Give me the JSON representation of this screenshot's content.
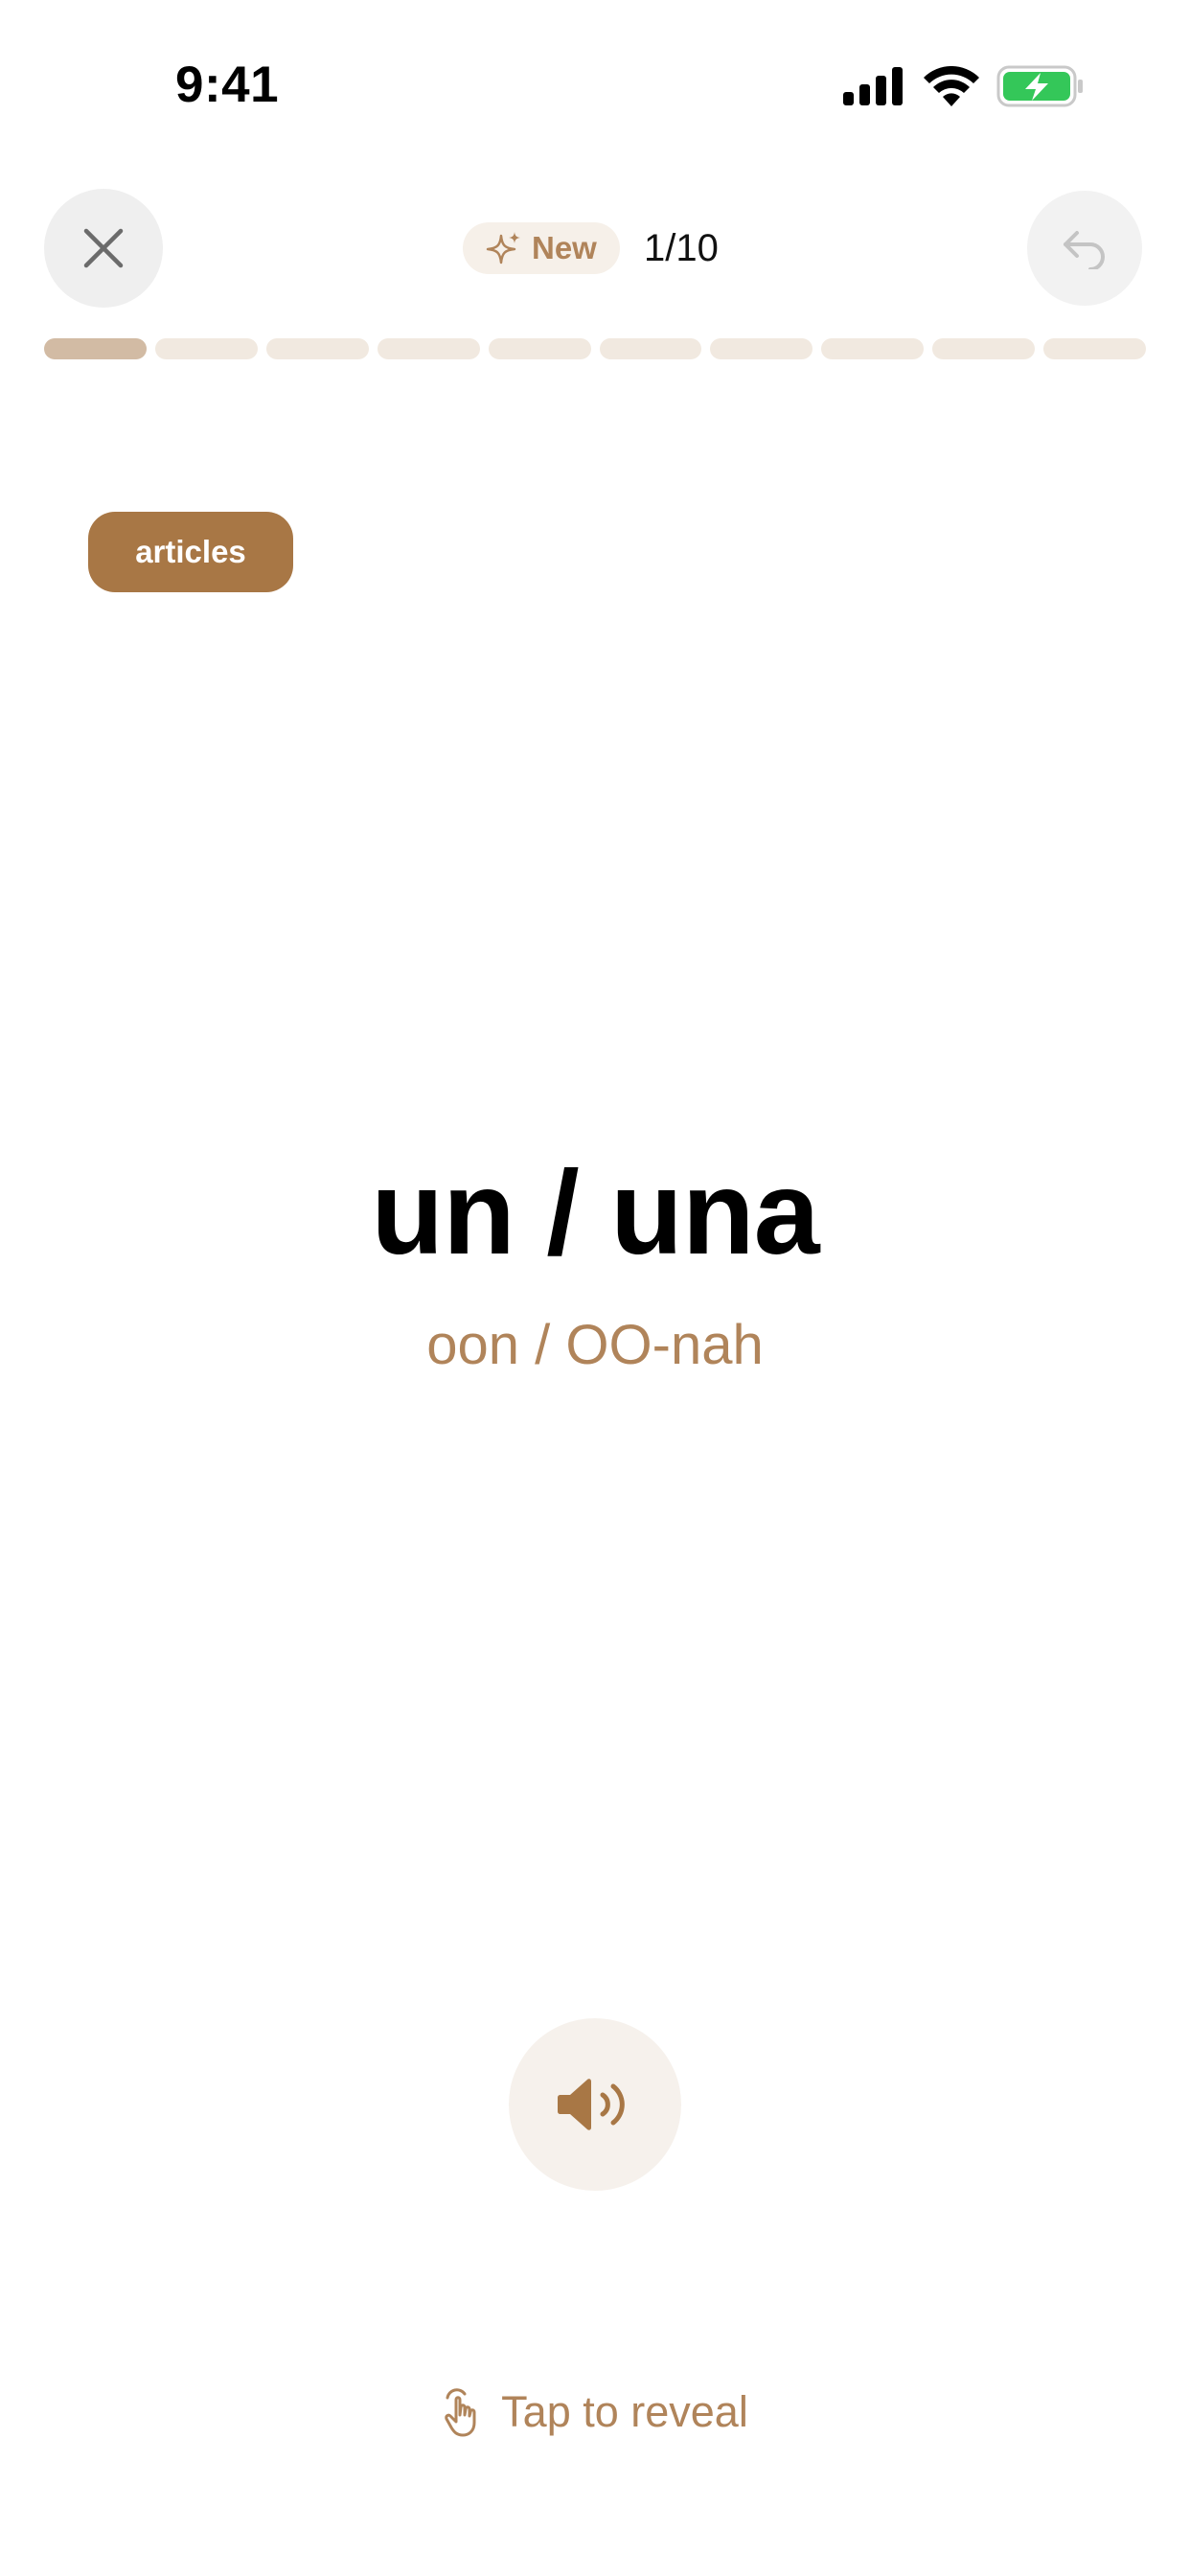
{
  "status_bar": {
    "time": "9:41"
  },
  "header": {
    "badge_label": "New",
    "counter": "1/10"
  },
  "progress": {
    "current": 1,
    "total": 10
  },
  "card": {
    "category": "articles",
    "word": "un / una",
    "pronunciation": "oon / OO-nah"
  },
  "hint": {
    "label": "Tap to reveal"
  },
  "icons": {
    "close": "close-icon",
    "undo": "undo-icon",
    "sparkle": "sparkle-icon",
    "speaker": "speaker-icon",
    "tap": "tap-hand-icon"
  },
  "colors": {
    "accent": "#a87745",
    "accent_text": "#b0845a",
    "battery": "#34c759"
  }
}
